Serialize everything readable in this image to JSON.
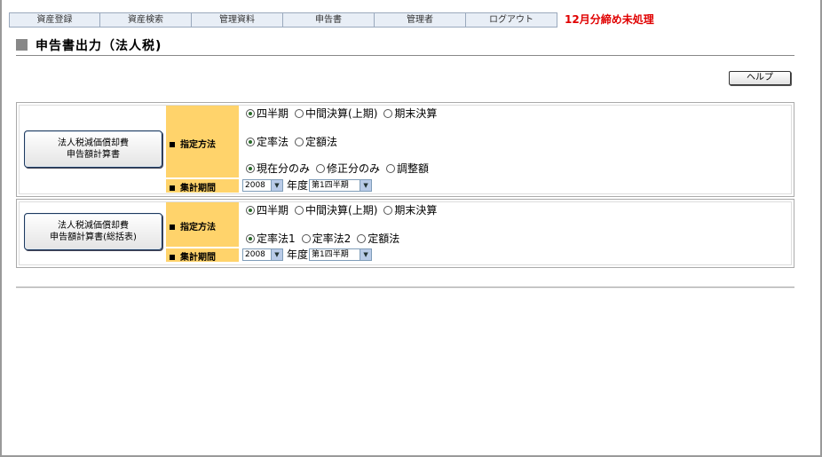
{
  "nav": {
    "items": [
      "資産登録",
      "資産検索",
      "管理資料",
      "申告書",
      "管理者",
      "ログアウト"
    ],
    "alert": "12月分締め未処理"
  },
  "page": {
    "title": "申告書出力（法人税)"
  },
  "help": {
    "label": "ヘルプ"
  },
  "panel1": {
    "button": {
      "line1": "法人税減価償却費",
      "line2": "申告額計算書"
    },
    "method_label": "指定方法",
    "period_label": "集計期間",
    "period_options": [
      "四半期",
      "中間決算(上期)",
      "期末決算"
    ],
    "period_selected": "四半期",
    "calc_options": [
      "定率法",
      "定額法"
    ],
    "calc_selected": "定率法",
    "scope_options": [
      "現在分のみ",
      "修正分のみ",
      "調整額"
    ],
    "scope_selected": "現在分のみ",
    "year": "2008",
    "year_unit": "年度",
    "quarter": "第1四半期"
  },
  "panel2": {
    "button": {
      "line1": "法人税減価償却費",
      "line2": "申告額計算書(総括表)"
    },
    "method_label": "指定方法",
    "period_label": "集計期間",
    "period_options": [
      "四半期",
      "中間決算(上期)",
      "期末決算"
    ],
    "period_selected": "四半期",
    "calc_options": [
      "定率法1",
      "定率法2",
      "定額法"
    ],
    "calc_selected": "定率法1",
    "year": "2008",
    "year_unit": "年度",
    "quarter": "第1四半期"
  },
  "colors": {
    "label_bg": "#ffd36b",
    "alert": "#e00000",
    "radio_dot": "#2a6b2a"
  }
}
